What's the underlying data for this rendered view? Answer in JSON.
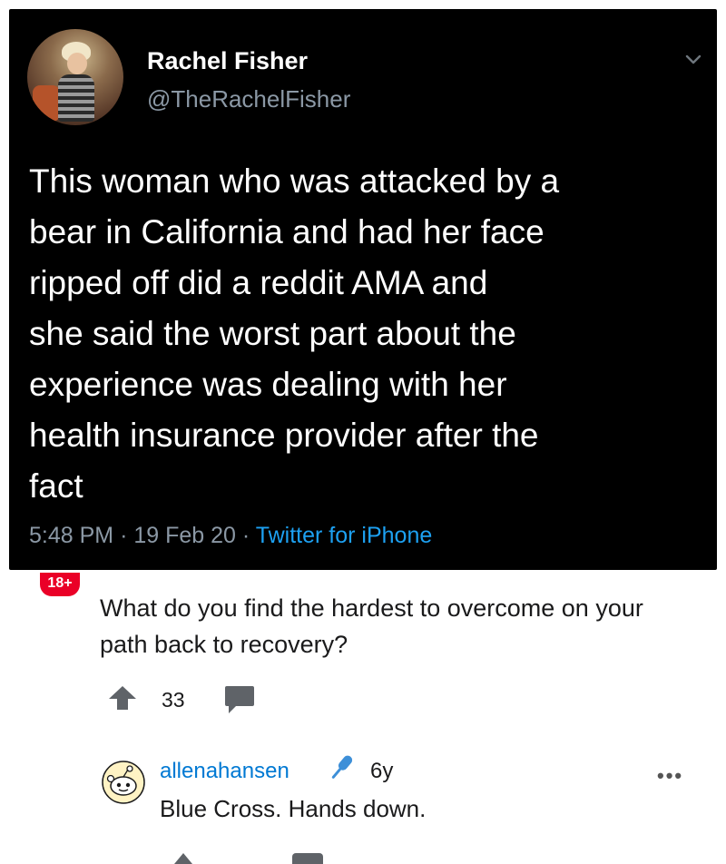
{
  "tweet": {
    "author_name": "Rachel Fisher",
    "handle": "@TheRachelFisher",
    "text": "This woman who was attacked by a\nbear in California and had her face\nripped off did a reddit AMA and\nshe said the worst part about the\nexperience was dealing with her\nhealth insurance provider after the\nfact",
    "time": "5:48 PM",
    "separator": "·",
    "date": "19 Feb 20",
    "source": "Twitter for iPhone",
    "icons": {
      "menu": "chevron-down-icon"
    }
  },
  "reddit": {
    "nsfw_badge": "18+",
    "question": "What do you find the hardest to overcome on your path back to recovery?",
    "vote_count": "33",
    "comment": {
      "username": "allenahansen",
      "age": "6y",
      "body": "Blue Cross. Hands down.",
      "more": "•••"
    },
    "icons": {
      "upvote": "upvote-arrow-icon",
      "comment": "comment-bubble-icon",
      "avatar": "snoo-avatar-icon",
      "flair": "microphone-icon",
      "more": "more-options-icon"
    },
    "colors": {
      "nsfw": "#ea0027",
      "username": "#0079d3",
      "twitter_link": "#1da1f2"
    }
  }
}
